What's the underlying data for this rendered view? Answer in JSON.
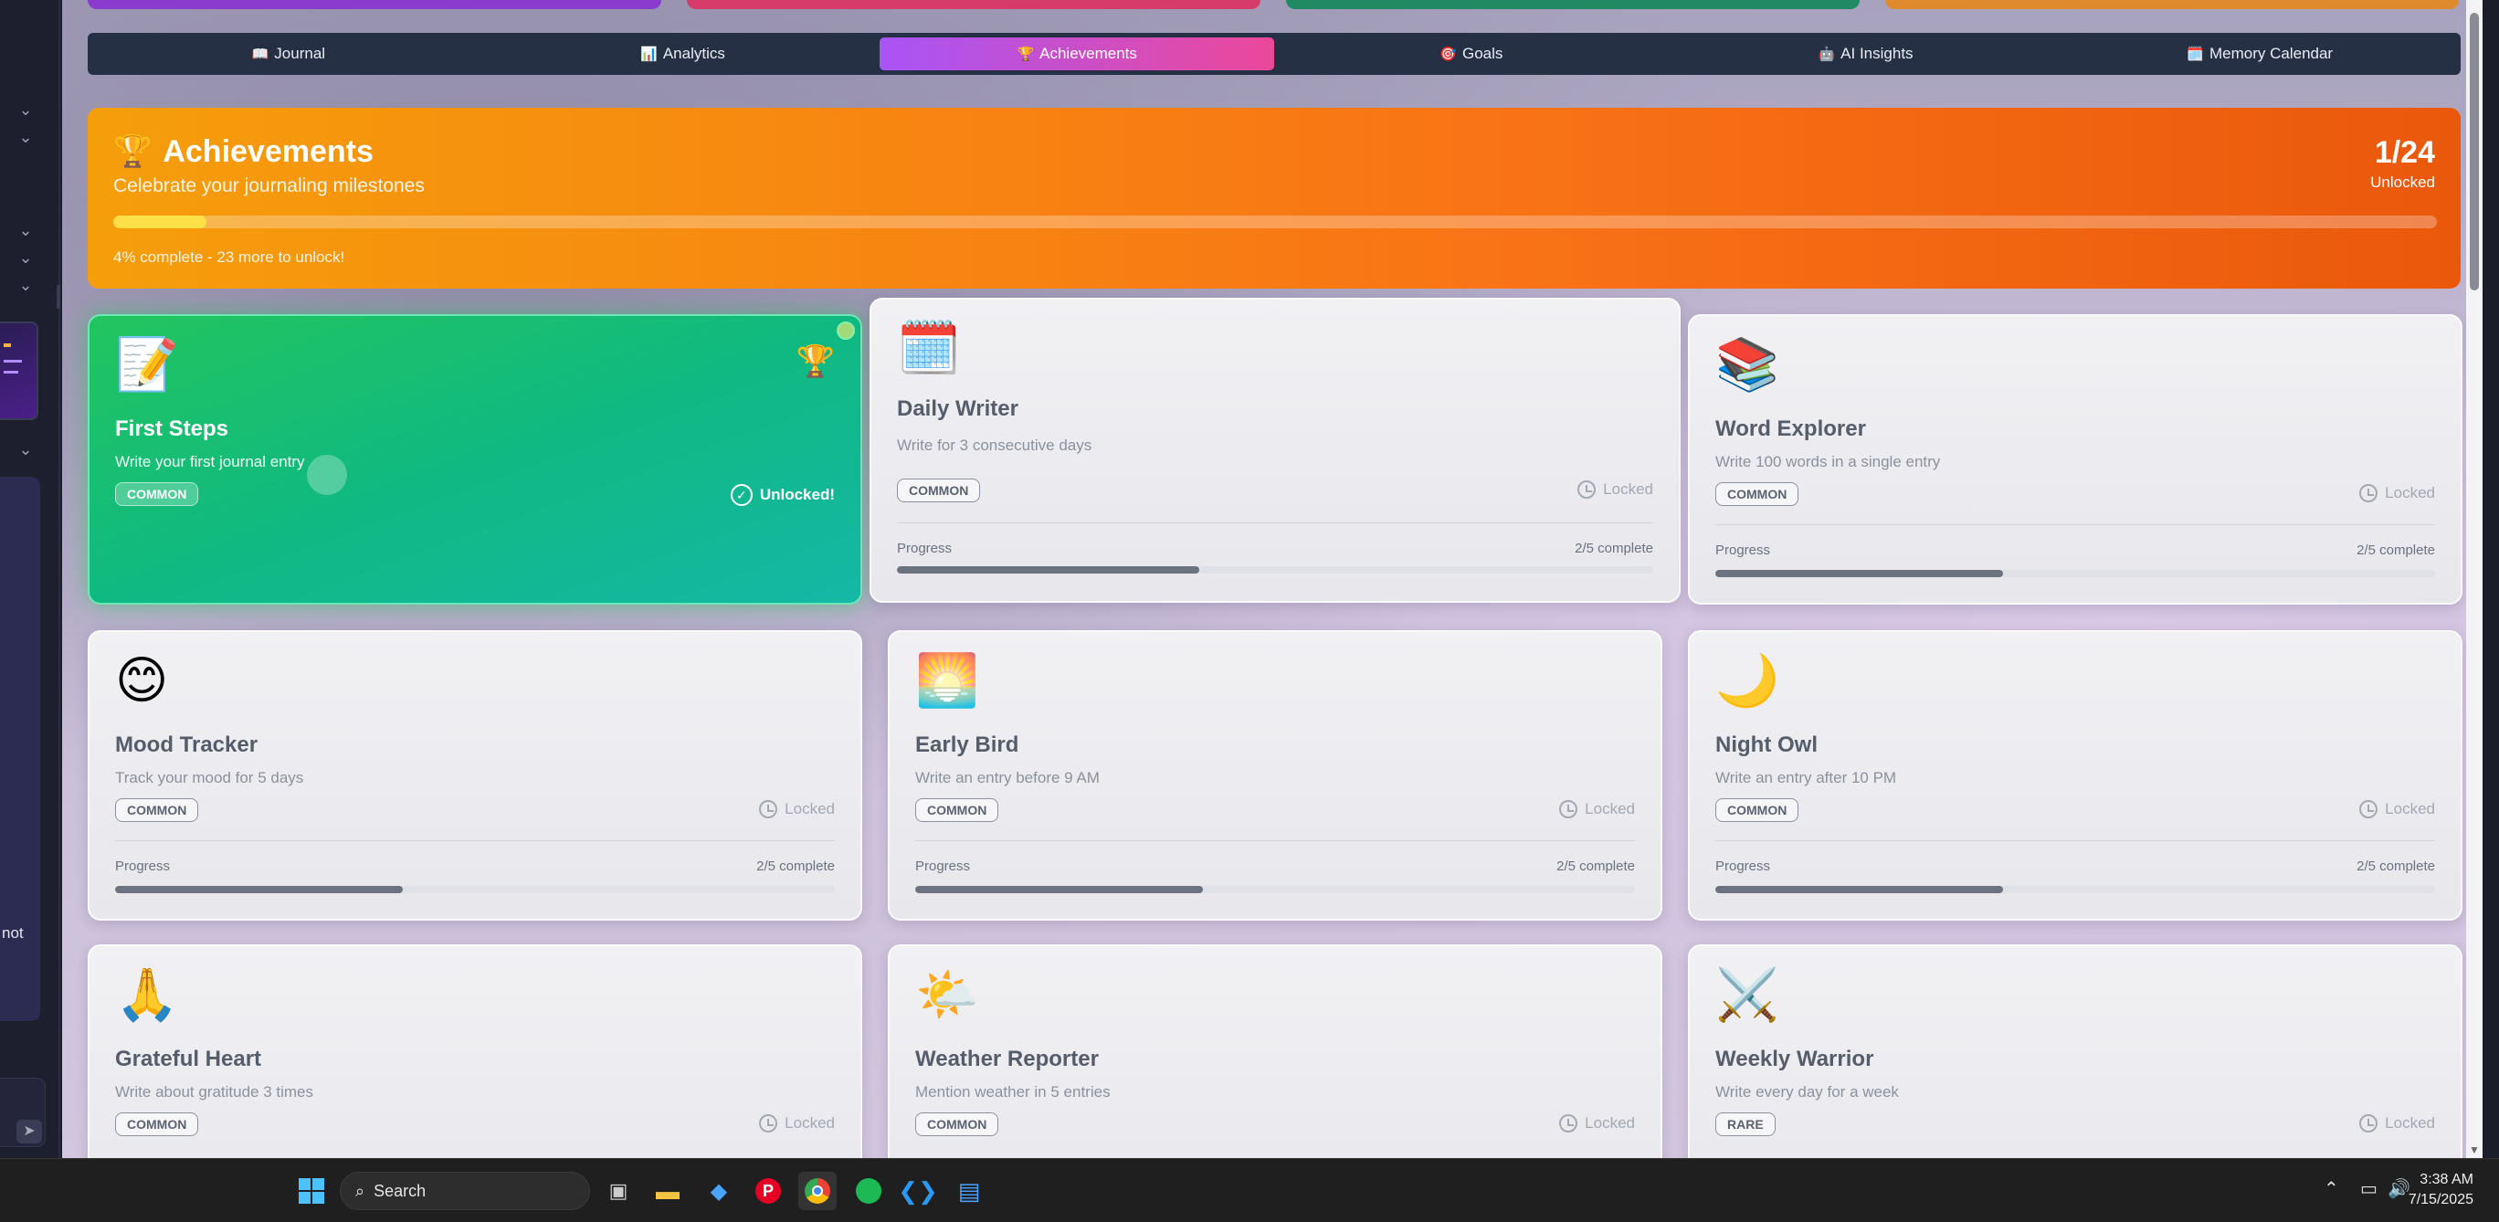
{
  "tabs": [
    {
      "icon": "📖",
      "label": "Journal",
      "active": false
    },
    {
      "icon": "📊",
      "label": "Analytics",
      "active": false
    },
    {
      "icon": "🏆",
      "label": "Achievements",
      "active": true
    },
    {
      "icon": "🎯",
      "label": "Goals",
      "active": false
    },
    {
      "icon": "🤖",
      "label": "AI Insights",
      "active": false
    },
    {
      "icon": "🗓️",
      "label": "Memory Calendar",
      "active": false
    }
  ],
  "hero": {
    "icon": "🏆",
    "title": "Achievements",
    "subtitle": "Celebrate your journaling milestones",
    "count": "1/24",
    "count_label": "Unlocked",
    "progress_fraction": 0.04,
    "footer": "4% complete - 23 more to unlock!"
  },
  "common_labels": {
    "progress": "Progress"
  },
  "achievements": [
    {
      "icon": "📝",
      "title": "First Steps",
      "desc": "Write your first journal entry",
      "rarity": "COMMON",
      "status": "Unlocked!",
      "unlocked": true
    },
    {
      "icon": "🗓️",
      "title": "Daily Writer",
      "desc": "Write for 3 consecutive days",
      "rarity": "COMMON",
      "status": "Locked",
      "unlocked": false,
      "progress_text": "2/5 complete",
      "progress_fraction": 0.4
    },
    {
      "icon": "📚",
      "title": "Word Explorer",
      "desc": "Write 100 words in a single entry",
      "rarity": "COMMON",
      "status": "Locked",
      "unlocked": false,
      "progress_text": "2/5 complete",
      "progress_fraction": 0.4
    },
    {
      "icon": "😊",
      "title": "Mood Tracker",
      "desc": "Track your mood for 5 days",
      "rarity": "COMMON",
      "status": "Locked",
      "unlocked": false,
      "progress_text": "2/5 complete",
      "progress_fraction": 0.4
    },
    {
      "icon": "🌅",
      "title": "Early Bird",
      "desc": "Write an entry before 9 AM",
      "rarity": "COMMON",
      "status": "Locked",
      "unlocked": false,
      "progress_text": "2/5 complete",
      "progress_fraction": 0.4
    },
    {
      "icon": "🌙",
      "title": "Night Owl",
      "desc": "Write an entry after 10 PM",
      "rarity": "COMMON",
      "status": "Locked",
      "unlocked": false,
      "progress_text": "2/5 complete",
      "progress_fraction": 0.4
    },
    {
      "icon": "🙏",
      "title": "Grateful Heart",
      "desc": "Write about gratitude 3 times",
      "rarity": "COMMON",
      "status": "Locked",
      "unlocked": false
    },
    {
      "icon": "🌤️",
      "title": "Weather Reporter",
      "desc": "Mention weather in 5 entries",
      "rarity": "COMMON",
      "status": "Locked",
      "unlocked": false
    },
    {
      "icon": "⚔️",
      "title": "Weekly Warrior",
      "desc": "Write every day for a week",
      "rarity": "RARE",
      "status": "Locked",
      "unlocked": false
    }
  ],
  "sidebar": {
    "partial_text": "not"
  },
  "taskbar": {
    "search_label": "Search",
    "time": "3:38 AM",
    "date": "7/15/2025"
  },
  "colors": {
    "hero_start": "#f59e0b",
    "hero_end": "#ea580c",
    "active_tab_start": "#a855f7",
    "active_tab_end": "#ec4899",
    "unlocked_card": "#10b981"
  }
}
